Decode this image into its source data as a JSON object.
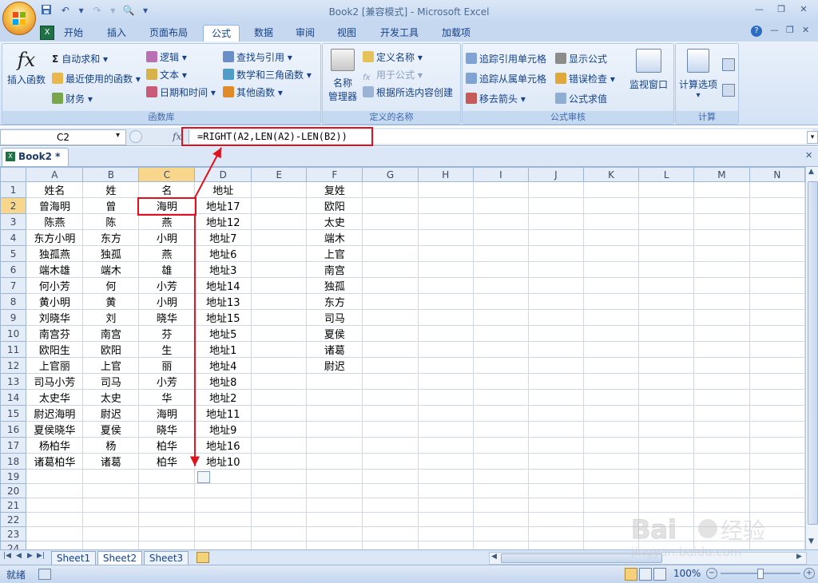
{
  "app": {
    "title": "Book2  [兼容模式] - Microsoft Excel"
  },
  "ribbon_tabs": [
    "开始",
    "插入",
    "页面布局",
    "公式",
    "数据",
    "审阅",
    "视图",
    "开发工具",
    "加载项"
  ],
  "active_tab": "公式",
  "ribbon": {
    "function_library": {
      "label": "函数库",
      "insert_function": "插入函数",
      "autosum": "自动求和",
      "recent": "最近使用的函数",
      "financial": "财务",
      "logical": "逻辑",
      "text": "文本",
      "datetime": "日期和时间",
      "lookup": "查找与引用",
      "math": "数学和三角函数",
      "other": "其他函数"
    },
    "defined_names": {
      "label": "定义的名称",
      "name_manager_1": "名称",
      "name_manager_2": "管理器",
      "define_name": "定义名称",
      "use_in_formula": "用于公式",
      "create_from_selection": "根据所选内容创建"
    },
    "formula_auditing": {
      "label": "公式审核",
      "trace_precedents": "追踪引用单元格",
      "trace_dependents": "追踪从属单元格",
      "remove_arrows": "移去箭头",
      "show_formulas": "显示公式",
      "error_checking": "错误检查",
      "evaluate_formula": "公式求值",
      "watch_window": "监视窗口"
    },
    "calculation": {
      "label": "计算",
      "calc_options": "计算选项"
    }
  },
  "formula_bar": {
    "name_box": "C2",
    "fx": "fx",
    "formula": "=RIGHT(A2,LEN(A2)-LEN(B2))"
  },
  "workbook_tab": "Book2 *",
  "columns": [
    "A",
    "B",
    "C",
    "D",
    "E",
    "F",
    "G",
    "H",
    "I",
    "J",
    "K",
    "L",
    "M",
    "N"
  ],
  "rows": [
    [
      "姓名",
      "姓",
      "名",
      "地址",
      "",
      "复姓"
    ],
    [
      "曾海明",
      "曾",
      "海明",
      "地址17",
      "",
      "欧阳"
    ],
    [
      "陈燕",
      "陈",
      "燕",
      "地址12",
      "",
      "太史"
    ],
    [
      "东方小明",
      "东方",
      "小明",
      "地址7",
      "",
      "端木"
    ],
    [
      "独孤燕",
      "独孤",
      "燕",
      "地址6",
      "",
      "上官"
    ],
    [
      "端木雄",
      "端木",
      "雄",
      "地址3",
      "",
      "南宫"
    ],
    [
      "何小芳",
      "何",
      "小芳",
      "地址14",
      "",
      "独孤"
    ],
    [
      "黄小明",
      "黄",
      "小明",
      "地址13",
      "",
      "东方"
    ],
    [
      "刘晓华",
      "刘",
      "晓华",
      "地址15",
      "",
      "司马"
    ],
    [
      "南宫芬",
      "南宫",
      "芬",
      "地址5",
      "",
      "夏侯"
    ],
    [
      "欧阳生",
      "欧阳",
      "生",
      "地址1",
      "",
      "诸葛"
    ],
    [
      "上官丽",
      "上官",
      "丽",
      "地址4",
      "",
      "尉迟"
    ],
    [
      "司马小芳",
      "司马",
      "小芳",
      "地址8",
      "",
      ""
    ],
    [
      "太史华",
      "太史",
      "华",
      "地址2",
      "",
      ""
    ],
    [
      "尉迟海明",
      "尉迟",
      "海明",
      "地址11",
      "",
      ""
    ],
    [
      "夏侯晓华",
      "夏侯",
      "晓华",
      "地址9",
      "",
      ""
    ],
    [
      "杨柏华",
      "杨",
      "柏华",
      "地址16",
      "",
      ""
    ],
    [
      "诸葛柏华",
      "诸葛",
      "柏华",
      "地址10",
      "",
      ""
    ]
  ],
  "total_rows": 26,
  "selected_cell": {
    "column": "C",
    "row": 2
  },
  "sheets": [
    "Sheet1",
    "Sheet2",
    "Sheet3"
  ],
  "active_sheet": "Sheet2",
  "status": {
    "ready": "就绪",
    "zoom": "100%"
  },
  "watermark": "Baidu经验 jingyan.baidu.com",
  "colors": {
    "highlight_red": "#e0101c",
    "selected_header": "#f8d78c"
  }
}
